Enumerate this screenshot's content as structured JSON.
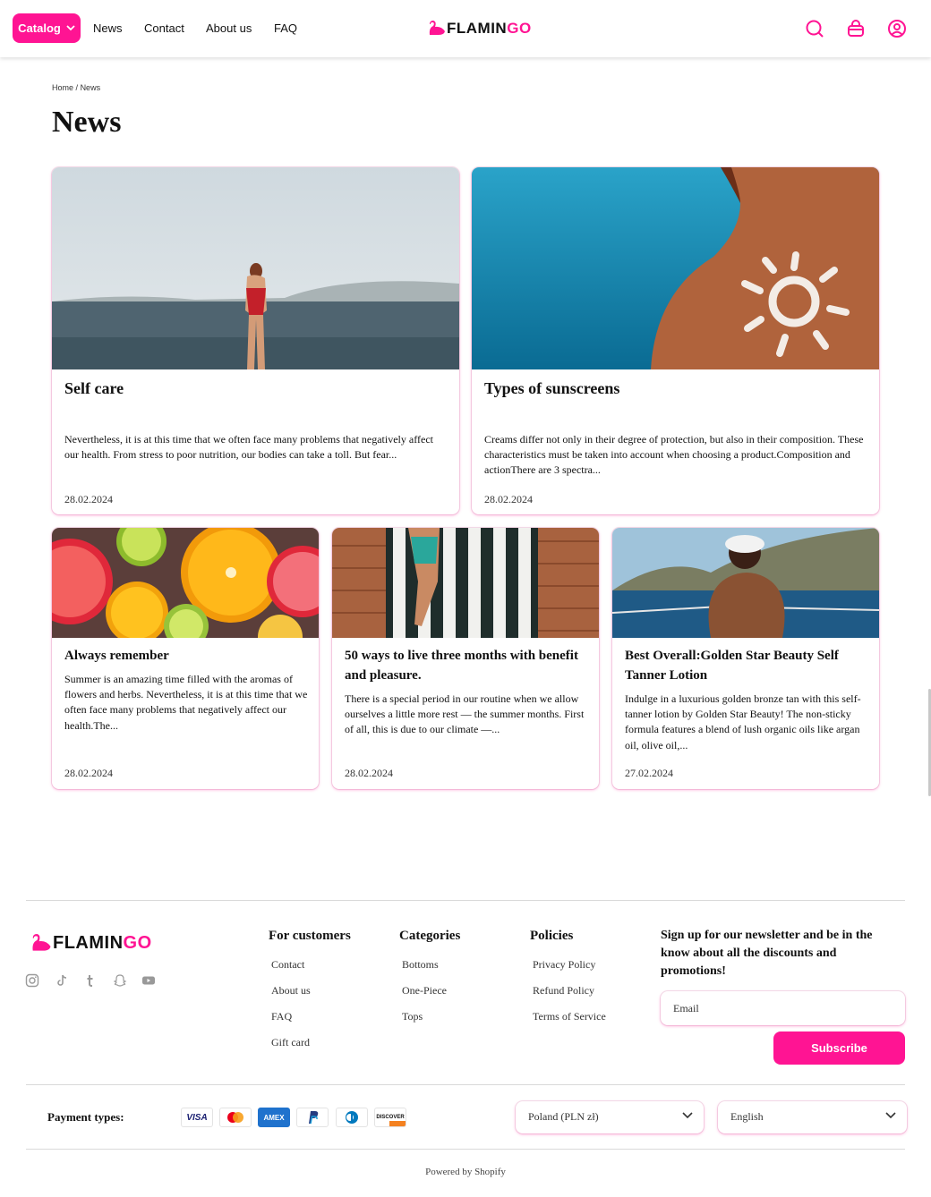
{
  "header": {
    "catalog_label": "Catalog",
    "nav": [
      "News",
      "Contact",
      "About us",
      "FAQ"
    ],
    "logo_prefix": "FLAMIN",
    "logo_suffix": "GO",
    "icons": [
      "search-icon",
      "bag-icon",
      "account-icon"
    ]
  },
  "breadcrumb": {
    "home": "Home",
    "separator": "/",
    "current": "News"
  },
  "page_title": "News",
  "articles": [
    {
      "title": "Self care",
      "excerpt": "Nevertheless, it is at this time that we often face many problems that negatively affect our health. From stress to poor nutrition, our bodies can take a toll. But fear...",
      "date": "28.02.2024"
    },
    {
      "title": "Types of sunscreens",
      "excerpt": "Creams differ not only in their degree of protection, but also in their composition. These characteristics must be taken into account when choosing a product.Composition and actionThere are 3 spectra...",
      "date": "28.02.2024"
    },
    {
      "title": "Always remember",
      "excerpt": "Summer is an amazing time filled with the aromas of flowers and herbs. Nevertheless, it is at this time that we often face many problems that negatively affect our health.The...",
      "date": "28.02.2024"
    },
    {
      "title": "50 ways to live three months with benefit and pleasure.",
      "excerpt": "There is a special period in our routine when we allow ourselves a little more rest — the summer months. First of all, this is due to our climate —...",
      "date": "28.02.2024"
    },
    {
      "title": "Best Overall:Golden Star Beauty Self Tanner Lotion",
      "excerpt": "Indulge in a luxurious golden bronze tan with this self-tanner lotion by Golden Star Beauty! The non-sticky formula features a blend of lush organic oils like argan oil, olive oil,...",
      "date": "27.02.2024"
    }
  ],
  "footer": {
    "social_icons": [
      "instagram-icon",
      "tiktok-icon",
      "tumblr-icon",
      "snapchat-icon",
      "youtube-icon"
    ],
    "columns": [
      {
        "title": "For customers",
        "links": [
          "Contact",
          "About us",
          "FAQ",
          "Gift card"
        ]
      },
      {
        "title": "Categories",
        "links": [
          "Bottoms",
          "One-Piece",
          "Tops"
        ]
      },
      {
        "title": "Policies",
        "links": [
          "Privacy Policy",
          "Refund Policy",
          "Terms of Service"
        ]
      }
    ],
    "newsletter": {
      "title": "Sign up for our newsletter and be in the know about all the discounts and promotions!",
      "email_placeholder": "Email",
      "subscribe_label": "Subscribe"
    },
    "payment_label": "Payment types:",
    "payment_methods": [
      "VISA",
      "Mastercard",
      "AMEX",
      "PayPal",
      "Diners Club",
      "DISCOVER"
    ],
    "country_select": "Poland (PLN zł)",
    "language_select": "English",
    "powered_by": "Powered by Shopify"
  },
  "colors": {
    "accent": "#ff1493",
    "text": "#111111",
    "muted": "#333333"
  }
}
